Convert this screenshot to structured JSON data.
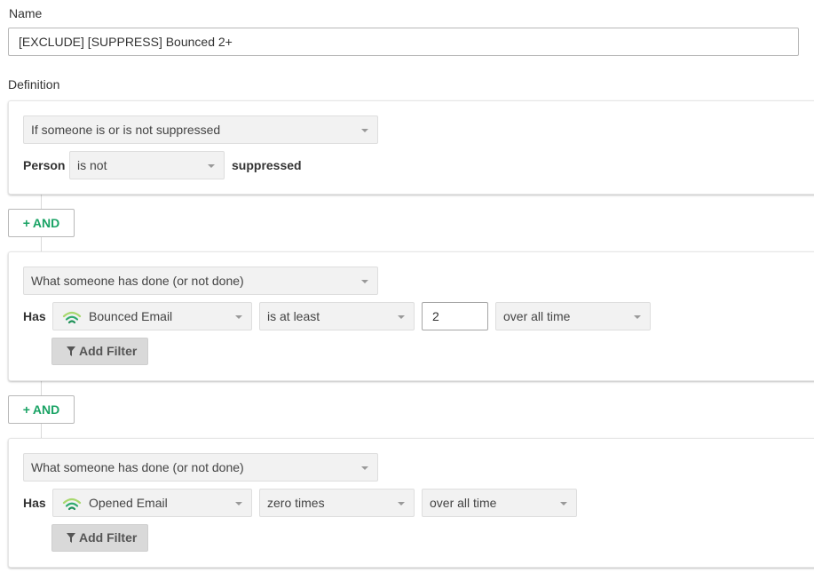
{
  "name_section": {
    "label": "Name",
    "value": "[EXCLUDE] [SUPPRESS] Bounced 2+"
  },
  "definition_label": "Definition",
  "and_button_label": "AND",
  "add_filter_label": "Add Filter",
  "conditions": [
    {
      "type_select": "If someone is or is not suppressed",
      "row_label": "Person",
      "operator_select": "is not",
      "suffix_text": "suppressed"
    },
    {
      "type_select": "What someone has done (or not done)",
      "row_label": "Has",
      "metric_select": "Bounced Email",
      "metric_icon": "email-signal-icon",
      "operator_select": "is at least",
      "count_value": "2",
      "timeframe_select": "over all time"
    },
    {
      "type_select": "What someone has done (or not done)",
      "row_label": "Has",
      "metric_select": "Opened Email",
      "metric_icon": "email-signal-icon",
      "operator_select": "zero times",
      "timeframe_select": "over all time"
    }
  ],
  "colors": {
    "accent_green": "#1aa365",
    "icon_green_light": "#a8d86e",
    "icon_green_dark": "#2eaa6e"
  }
}
